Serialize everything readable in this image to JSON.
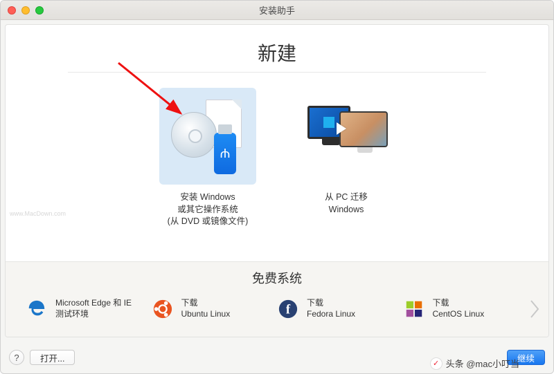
{
  "window": {
    "title": "安装助手"
  },
  "main": {
    "heading": "新建",
    "options": [
      {
        "label_line1": "安装 Windows",
        "label_line2": "或其它操作系统",
        "label_line3": "(从 DVD 或镜像文件)"
      },
      {
        "label_line1": "从 PC 迁移",
        "label_line2": "Windows",
        "label_line3": ""
      }
    ]
  },
  "free": {
    "title": "免费系统",
    "items": [
      {
        "line1": "Microsoft Edge 和 IE",
        "line2": "测试环境"
      },
      {
        "line1": "下载",
        "line2": "Ubuntu Linux"
      },
      {
        "line1": "下载",
        "line2": "Fedora Linux"
      },
      {
        "line1": "下载",
        "line2": "CentOS Linux"
      }
    ]
  },
  "footer": {
    "help_symbol": "?",
    "open_label": "打开...",
    "continue_label": "继续"
  },
  "watermark": {
    "text": "头条 @mac小叮当",
    "small": "www.MacDown.com"
  }
}
